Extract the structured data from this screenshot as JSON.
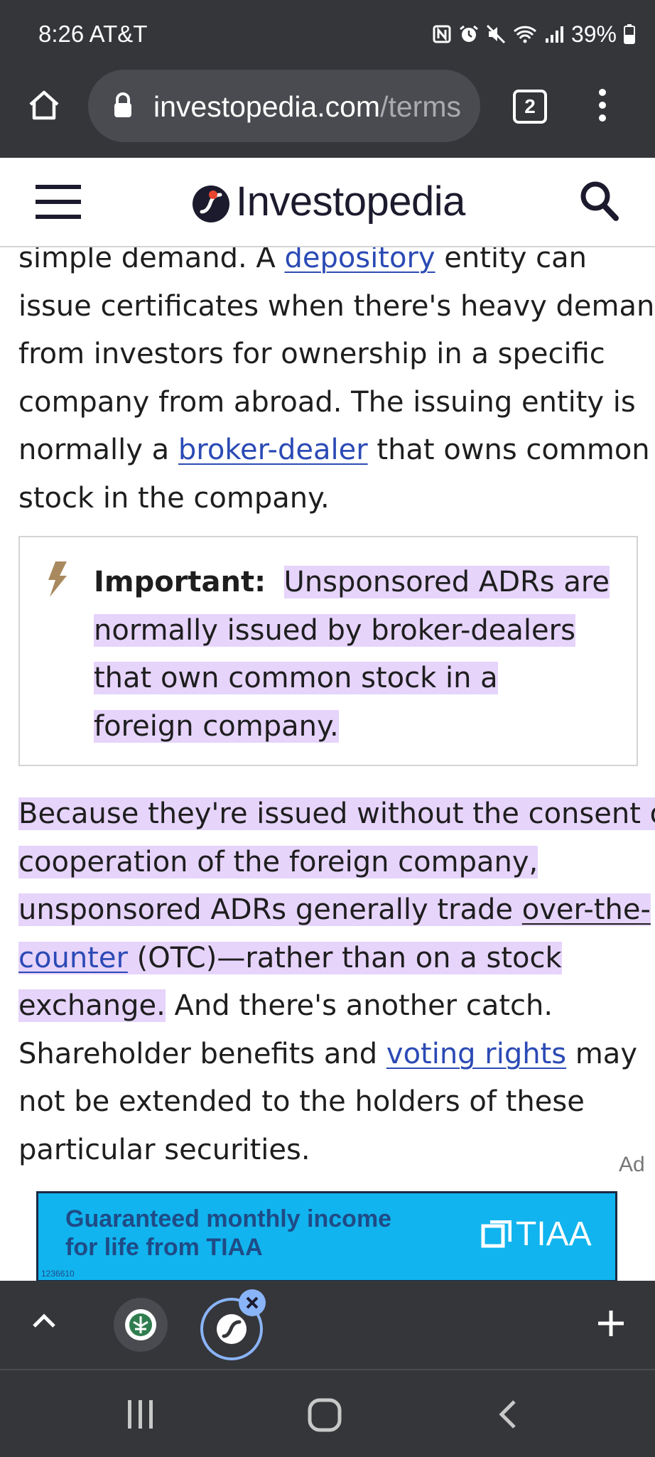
{
  "status_bar": {
    "time_carrier": "8:26 AT&T",
    "battery": "39%"
  },
  "browser": {
    "url_host": "investopedia.com",
    "url_path": "/terms",
    "tab_count": "2"
  },
  "site": {
    "name": "Investopedia"
  },
  "article": {
    "p1": {
      "l0a": "simple",
      "l0b": " demand. A ",
      "l0link": "depository",
      "l0c": " entity can",
      "l1": "issue certificates when there's heavy demand",
      "l2": "from investors for ownership in a specific",
      "l3": "company from abroad. The issuing entity is",
      "l4a": "normally a ",
      "l4link": "broker-dealer",
      "l4b": " that owns common",
      "l5": "stock in the company."
    },
    "callout": {
      "label": "Important:",
      "l1": "Unsponsored ADRs are",
      "l2": "normally issued by broker-dealers",
      "l3": "that own common stock in a",
      "l4": "foreign company."
    },
    "p2": {
      "l1": "Because they're issued without the consent or",
      "l2": "cooperation of the foreign company,",
      "l3a": "unsponsored ADRs generally trade ",
      "l3link": "over-the-",
      "l4link": "counter",
      "l4b": " (OTC)—rather than on a stock",
      "l5a": "exchange.",
      "l5b": " And there's another catch.",
      "l6a": "Shareholder benefits and ",
      "l6link": "voting rights",
      "l6b": " may",
      "l7": "not be extended to the holders of these",
      "l8": "particular securities."
    }
  },
  "ad": {
    "label": "Ad",
    "line1": "Guaranteed monthly income",
    "line2": "for life from TIAA",
    "brand": "TIAA",
    "code": "1236610"
  },
  "icons": {
    "home": "home-icon",
    "lock": "lock-icon",
    "menu": "more-vert-icon",
    "search": "search-icon",
    "hamburger": "hamburger-icon",
    "bolt": "bolt-icon",
    "plus": "plus-icon",
    "close": "close-icon"
  },
  "colors": {
    "chrome_bg": "#35363a",
    "link": "#2b4ab5",
    "highlight": "#e6d4fb",
    "ad_bg": "#11b4ee"
  }
}
